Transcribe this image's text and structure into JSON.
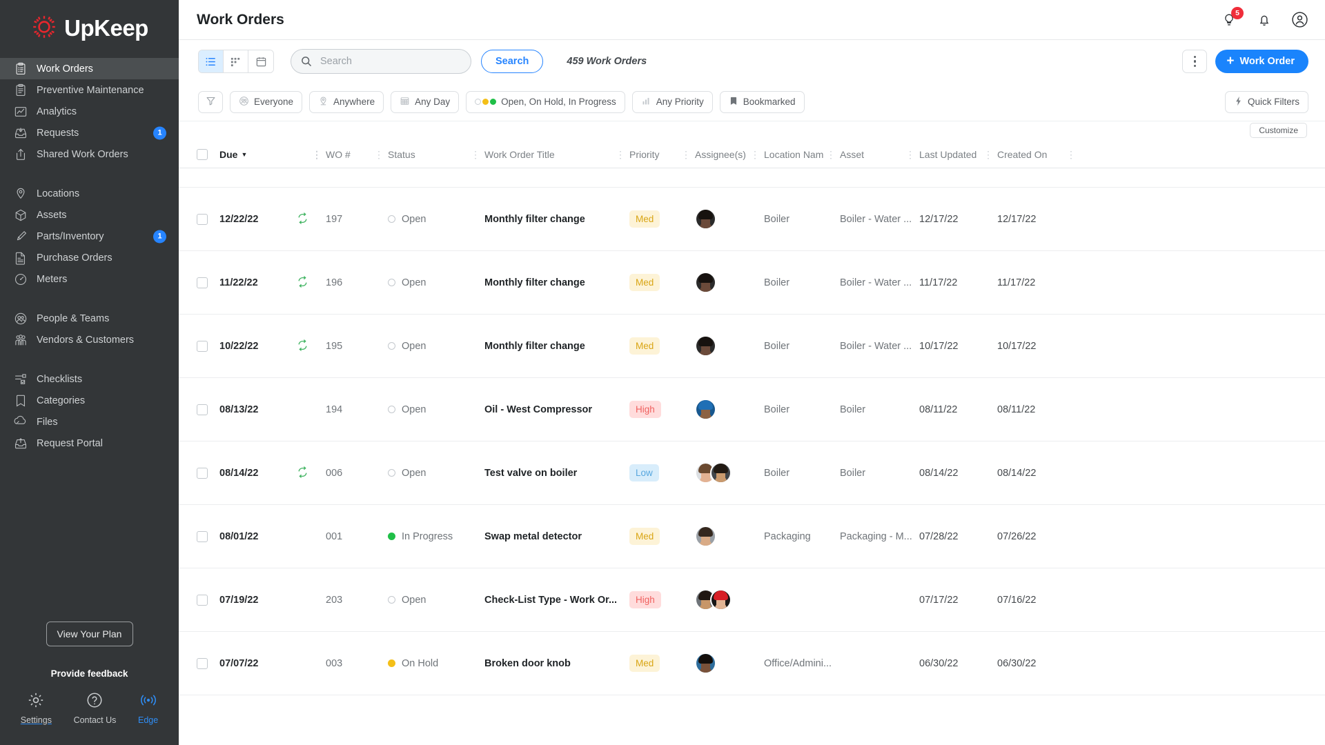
{
  "brand": {
    "name": "UpKeep",
    "logo_icon": "upkeep-gear-logo",
    "accent": "#e8262d"
  },
  "sidebar": {
    "items": [
      {
        "label": "Work Orders",
        "icon": "clipboard-list-icon",
        "active": true,
        "badge": ""
      },
      {
        "label": "Preventive Maintenance",
        "icon": "clipboard-icon",
        "active": false,
        "badge": ""
      },
      {
        "label": "Analytics",
        "icon": "chart-icon",
        "active": false,
        "badge": ""
      },
      {
        "label": "Requests",
        "icon": "inbox-down-icon",
        "active": false,
        "badge": "1"
      },
      {
        "label": "Shared Work Orders",
        "icon": "share-icon",
        "active": false,
        "badge": ""
      },
      {
        "label": "Locations",
        "icon": "map-pin-icon",
        "active": false,
        "badge": "",
        "gap_before": true
      },
      {
        "label": "Assets",
        "icon": "cube-icon",
        "active": false,
        "badge": ""
      },
      {
        "label": "Parts/Inventory",
        "icon": "bolt-part-icon",
        "active": false,
        "badge": "1"
      },
      {
        "label": "Purchase Orders",
        "icon": "document-icon",
        "active": false,
        "badge": ""
      },
      {
        "label": "Meters",
        "icon": "gauge-icon",
        "active": false,
        "badge": ""
      },
      {
        "label": "People & Teams",
        "icon": "people-icon",
        "active": false,
        "badge": "",
        "gap_before": true
      },
      {
        "label": "Vendors & Customers",
        "icon": "group-icon",
        "active": false,
        "badge": ""
      },
      {
        "label": "Checklists",
        "icon": "checklist-icon",
        "active": false,
        "badge": "",
        "gap_before": true
      },
      {
        "label": "Categories",
        "icon": "bookmark-icon",
        "active": false,
        "badge": ""
      },
      {
        "label": "Files",
        "icon": "file-icon",
        "active": false,
        "badge": ""
      },
      {
        "label": "Request Portal",
        "icon": "portal-inbox-icon",
        "active": false,
        "badge": ""
      }
    ],
    "plan_button": "View Your Plan",
    "feedback": "Provide feedback",
    "bottom": [
      {
        "label": "Settings",
        "icon": "gear-icon"
      },
      {
        "label": "Contact Us",
        "icon": "question-circle-icon"
      },
      {
        "label": "Edge",
        "icon": "broadcast-icon"
      }
    ]
  },
  "header": {
    "title": "Work Orders",
    "icons": [
      {
        "name": "lightbulb-icon",
        "badge": "5"
      },
      {
        "name": "bell-icon",
        "badge": ""
      },
      {
        "name": "user-avatar-icon",
        "badge": ""
      }
    ]
  },
  "toolbar": {
    "views": [
      {
        "name": "list-view",
        "icon": "list-icon",
        "active": true
      },
      {
        "name": "board-view",
        "icon": "grid-icon",
        "active": false
      },
      {
        "name": "calendar-view",
        "icon": "calendar-icon",
        "active": false
      }
    ],
    "search_placeholder": "Search",
    "search_value": "",
    "search_button": "Search",
    "count_label": "459 Work Orders",
    "more_button": "kebab-menu",
    "new_button": "Work Order",
    "new_button_prefix": "+"
  },
  "filters": {
    "filter_icon": "funnel-icon",
    "chips": [
      {
        "label": "Everyone",
        "icon": "people-icon"
      },
      {
        "label": "Anywhere",
        "icon": "location-icon"
      },
      {
        "label": "Any Day",
        "icon": "calendar-icon"
      },
      {
        "label": "Open, On Hold, In Progress",
        "icon": "status-dots-icon"
      },
      {
        "label": "Any Priority",
        "icon": "bars-icon"
      },
      {
        "label": "Bookmarked",
        "icon": "bookmark-icon"
      }
    ],
    "quick_filters": "Quick Filters",
    "quick_filters_icon": "lightning-icon",
    "customize": "Customize"
  },
  "table": {
    "columns": [
      {
        "label": "Due",
        "sorted": true,
        "sort_dir": "desc"
      },
      {
        "label": "WO #"
      },
      {
        "label": "Status"
      },
      {
        "label": "Work Order Title"
      },
      {
        "label": "Priority"
      },
      {
        "label": "Assignee(s)"
      },
      {
        "label": "Location Nam"
      },
      {
        "label": "Asset"
      },
      {
        "label": "Last Updated"
      },
      {
        "label": "Created On"
      }
    ],
    "rows": [
      {
        "due": "12/22/22",
        "recurring": true,
        "wo": "197",
        "status": "Open",
        "status_color": "#ffffff",
        "title": "Monthly filter change",
        "priority": "Med",
        "assignees": [
          {
            "skin": "#6b4a3a",
            "hair": "#17120f",
            "shirt": "#2b2b2b"
          }
        ],
        "location": "Boiler",
        "asset": "Boiler - Water ...",
        "updated": "12/17/22",
        "created": "12/17/22"
      },
      {
        "due": "11/22/22",
        "recurring": true,
        "wo": "196",
        "status": "Open",
        "status_color": "#ffffff",
        "title": "Monthly filter change",
        "priority": "Med",
        "assignees": [
          {
            "skin": "#6b4a3a",
            "hair": "#17120f",
            "shirt": "#2b2b2b"
          }
        ],
        "location": "Boiler",
        "asset": "Boiler - Water ...",
        "updated": "11/17/22",
        "created": "11/17/22"
      },
      {
        "due": "10/22/22",
        "recurring": true,
        "wo": "195",
        "status": "Open",
        "status_color": "#ffffff",
        "title": "Monthly filter change",
        "priority": "Med",
        "assignees": [
          {
            "skin": "#6b4a3a",
            "hair": "#17120f",
            "shirt": "#2b2b2b"
          }
        ],
        "location": "Boiler",
        "asset": "Boiler - Water ...",
        "updated": "10/17/22",
        "created": "10/17/22"
      },
      {
        "due": "08/13/22",
        "recurring": false,
        "wo": "194",
        "status": "Open",
        "status_color": "#ffffff",
        "title": "Oil - West Compressor",
        "priority": "High",
        "assignees": [
          {
            "skin": "#8c6243",
            "hair": "#1f6fb5",
            "shirt": "#18588f"
          }
        ],
        "location": "Boiler",
        "asset": "Boiler",
        "updated": "08/11/22",
        "created": "08/11/22"
      },
      {
        "due": "08/14/22",
        "recurring": true,
        "wo": "006",
        "status": "Open",
        "status_color": "#ffffff",
        "title": "Test valve on boiler",
        "priority": "Low",
        "assignees": [
          {
            "skin": "#e3b293",
            "hair": "#6b4a30",
            "shirt": "#dcdfe2"
          },
          {
            "skin": "#c99a6e",
            "hair": "#221a13",
            "shirt": "#41464b"
          }
        ],
        "location": "Boiler",
        "asset": "Boiler",
        "updated": "08/14/22",
        "created": "08/14/22"
      },
      {
        "due": "08/01/22",
        "recurring": false,
        "wo": "001",
        "status": "In Progress",
        "status_color": "#1fbf47",
        "title": "Swap metal detector",
        "priority": "Med",
        "assignees": [
          {
            "skin": "#d9ab86",
            "hair": "#35281e",
            "shirt": "#9aa0a6"
          }
        ],
        "location": "Packaging",
        "asset": "Packaging - M...",
        "updated": "07/28/22",
        "created": "07/26/22"
      },
      {
        "due": "07/19/22",
        "recurring": false,
        "wo": "203",
        "status": "Open",
        "status_color": "#ffffff",
        "title": "Check-List Type - Work Or...",
        "priority": "High",
        "assignees": [
          {
            "skin": "#c79668",
            "hair": "#201712",
            "shirt": "#6f7479"
          },
          {
            "skin": "#e0b494",
            "hair": "#d61f26",
            "shirt": "#171717"
          }
        ],
        "location": "",
        "asset": "",
        "updated": "07/17/22",
        "created": "07/16/22"
      },
      {
        "due": "07/07/22",
        "recurring": false,
        "wo": "003",
        "status": "On Hold",
        "status_color": "#f4bf18",
        "title": "Broken door knob",
        "priority": "Med",
        "assignees": [
          {
            "skin": "#7a523a",
            "hair": "#140f0c",
            "shirt": "#2e6d9c"
          }
        ],
        "location": "Office/Admini...",
        "asset": "",
        "updated": "06/30/22",
        "created": "06/30/22"
      }
    ]
  }
}
